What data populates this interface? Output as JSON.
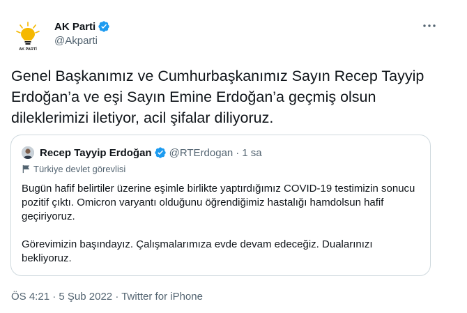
{
  "author": {
    "name": "AK Parti",
    "handle": "@Akparti",
    "avatar_icon": "ak-parti-logo-icon",
    "avatar_caption": "AK PARTİ",
    "verified_icon": "verified-badge-icon"
  },
  "more_icon": "more-options-icon",
  "tweet_text": "Genel Başkanımız ve Cumhurbaşkanımız Sayın Recep Tayyip Erdoğan’a ve eşi Sayın Emine Erdoğan’a geçmiş olsun dileklerimizi iletiyor, acil şifalar diliyoruz.",
  "quote": {
    "name": "Recep Tayyip Erdoğan",
    "handle": "@RTErdogan",
    "separator": "·",
    "time": "1 sa",
    "label": "Türkiye devlet görevlisi",
    "text": "Bugün hafif belirtiler üzerine eşimle birlikte yaptırdığımız COVID-19 testimizin sonucu pozitif çıktı. Omicron varyantı olduğunu öğrendiğimiz hastalığı hamdolsun hafif geçiriyoruz.\n\nGörevimizin başındayız. Çalışmalarımıza evde devam edeceğiz. Dualarınızı bekliyoruz."
  },
  "meta": {
    "time": "ÖS 4:21",
    "separator": "·",
    "date": "5 Şub 2022",
    "source": "Twitter for iPhone"
  },
  "colors": {
    "text": "#0f1419",
    "secondary": "#536471",
    "verified": "#1d9bf0",
    "border": "#cfd9de",
    "logo_yellow": "#f5b800",
    "logo_text": "#1a1a1a"
  }
}
